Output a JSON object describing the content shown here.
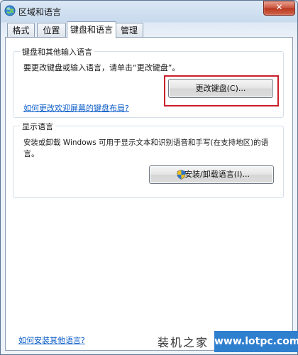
{
  "window": {
    "title": "区域和语言",
    "close_symbol": "✕"
  },
  "tabs": [
    {
      "label": "格式",
      "active": false
    },
    {
      "label": "位置",
      "active": false
    },
    {
      "label": "键盘和语言",
      "active": true
    },
    {
      "label": "管理",
      "active": false
    }
  ],
  "keyboard_group": {
    "title": "键盘和其他输入语言",
    "description": "要更改键盘或输入语言，请单击“更改键盘”。",
    "button_label": "更改键盘(C)...",
    "link": "如何更改欢迎屏幕的键盘布局?"
  },
  "display_group": {
    "title": "显示语言",
    "description_line1": "安装或卸载 Windows 可用于显示文本和识别语音和手写(在支持地区)的语",
    "description_line2": "言。",
    "button_label": "安装/卸载语言(I)..."
  },
  "footer_link": "如何安装其他语言?",
  "watermark": {
    "text": "装机之家",
    "url": "www.lotpc.com"
  },
  "colors": {
    "highlight": "#c8202a",
    "link": "#0b5cc7",
    "watermark_bg": "#2f7fcf"
  }
}
